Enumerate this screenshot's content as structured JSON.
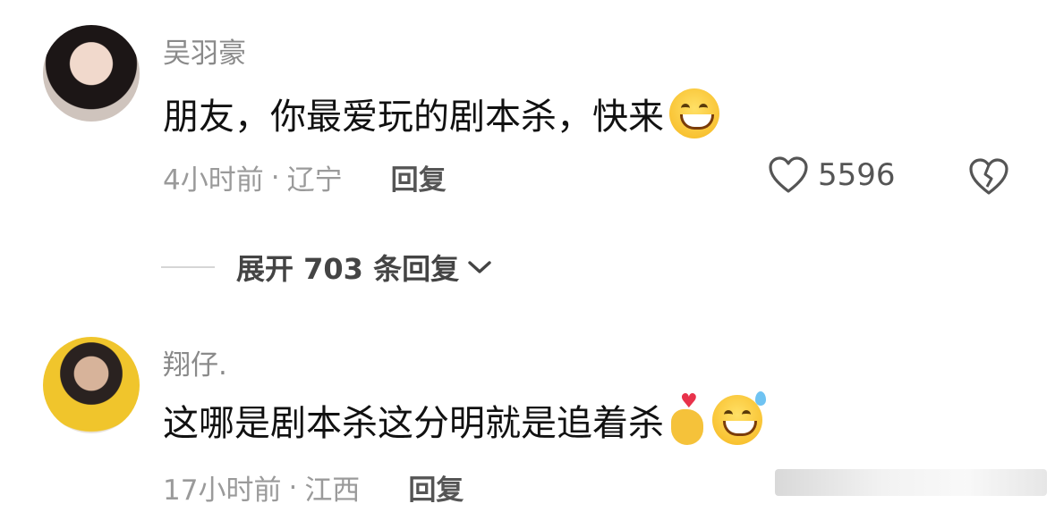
{
  "comments": [
    {
      "username": "吴羽豪",
      "text": "朋友，你最爱玩的剧本杀，快来",
      "time": "4小时前",
      "location": "辽宁",
      "reply_label": "回复",
      "like_count": "5596",
      "emojis": [
        "grin-emoji"
      ]
    },
    {
      "username": "翔仔.",
      "text": "这哪是剧本杀这分明就是追着杀",
      "time": "17小时前",
      "location": "江西",
      "reply_label": "回复",
      "emojis": [
        "finger-heart-emoji",
        "grimace-sweat-emoji"
      ]
    }
  ],
  "expand_replies": "展开 703 条回复",
  "separator": "·"
}
